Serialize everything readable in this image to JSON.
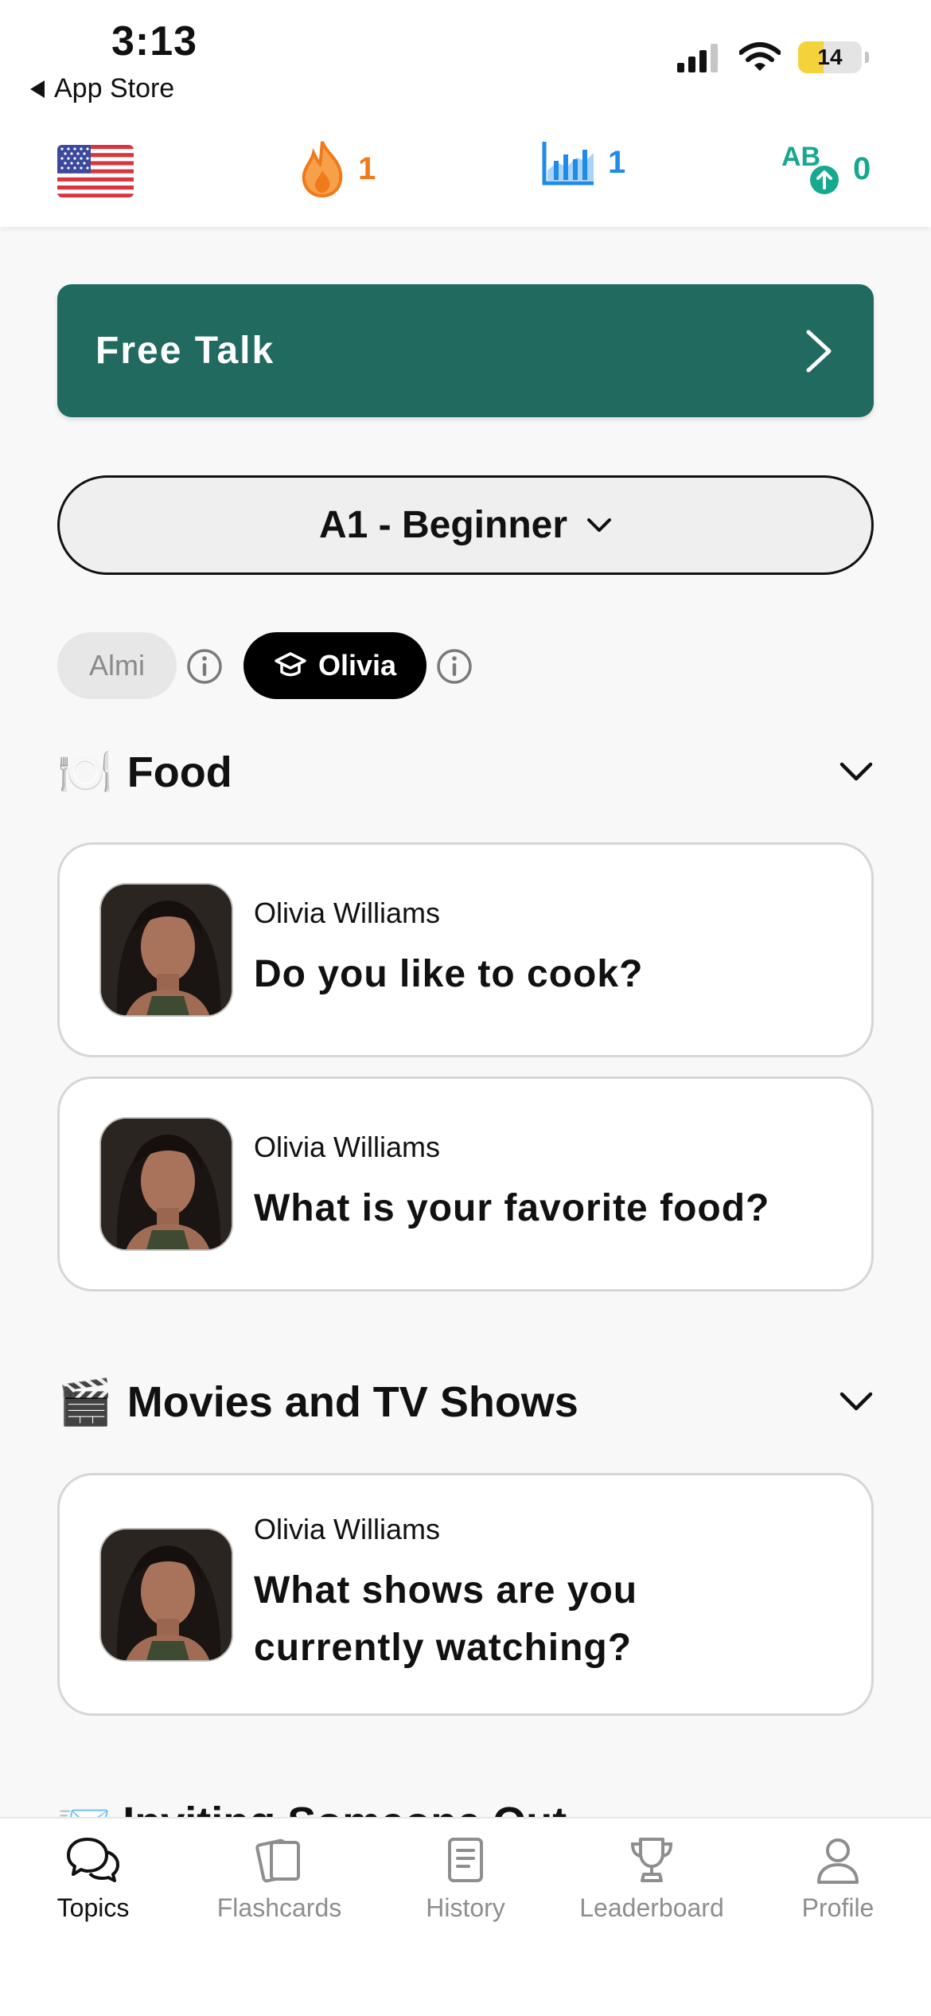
{
  "status_bar": {
    "time": "3:13",
    "back_label": "App Store",
    "battery_level": "14",
    "battery_fraction": 0.14
  },
  "stats": {
    "streak": "1",
    "level": "1",
    "words": "0",
    "icons": [
      "us-flag-icon",
      "flame-icon",
      "bar-chart-icon",
      "ab-up-icon"
    ]
  },
  "free_talk": {
    "label": "Free Talk"
  },
  "level_select": {
    "label": "A1 - Beginner"
  },
  "tutors": [
    {
      "label": "Almi",
      "selected": false
    },
    {
      "label": "Olivia",
      "selected": true
    }
  ],
  "sections": [
    {
      "emoji": "🍽️",
      "title": "Food",
      "cards": [
        {
          "author": "Olivia Williams",
          "question": "Do you like to cook?"
        },
        {
          "author": "Olivia Williams",
          "question": "What is your favorite food?"
        }
      ]
    },
    {
      "emoji": "🎬",
      "title": "Movies and TV Shows",
      "cards": [
        {
          "author": "Olivia Williams",
          "question": " What shows are you currently watching?"
        }
      ]
    }
  ],
  "peek_text": "📨 Inviting Someone Out",
  "tabs": [
    {
      "label": "Topics",
      "active": true
    },
    {
      "label": "Flashcards",
      "active": false
    },
    {
      "label": "History",
      "active": false
    },
    {
      "label": "Leaderboard",
      "active": false
    },
    {
      "label": "Profile",
      "active": false
    }
  ],
  "colors": {
    "accent_green": "#216a60",
    "streak_orange": "#f07a1a",
    "level_blue": "#1f8be8",
    "words_teal": "#17a890"
  }
}
